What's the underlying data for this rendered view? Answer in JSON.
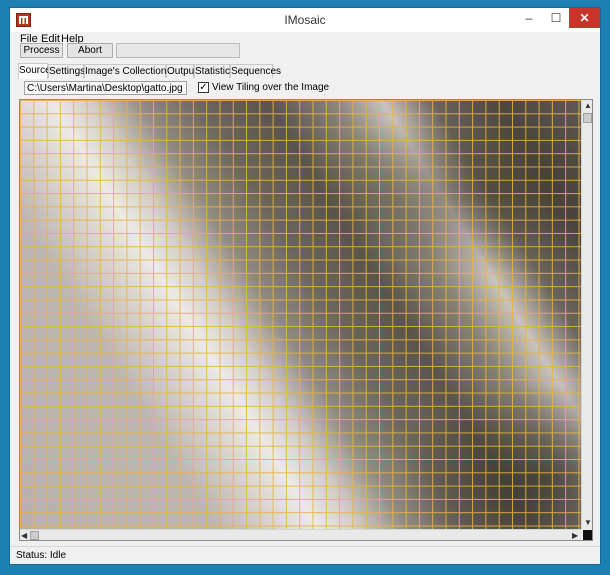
{
  "window": {
    "title": "IMosaic"
  },
  "window_controls": {
    "minimize": "–",
    "maximize": "☐",
    "close": "✕"
  },
  "menu": {
    "items": [
      "File",
      "Edit",
      "Help"
    ]
  },
  "toolbar": {
    "process_label": "Process",
    "abort_label": "Abort"
  },
  "tabs": [
    "Source",
    "Settings",
    "Image's Collections",
    "Output",
    "Statistics",
    "Sequences"
  ],
  "active_tab": "Source",
  "source": {
    "path": "C:\\Users\\Martina\\Desktop\\gatto.jpg",
    "view_tiling_checked": true,
    "view_tiling_label": "View Tiling over the Image"
  },
  "scroll": {
    "up": "▲",
    "down": "▼",
    "left": "◀",
    "right": "▶"
  },
  "status": {
    "text": "Status: Idle"
  },
  "colors": {
    "tile_grid": "#e8b43e",
    "close_button": "#c7352b",
    "desktop": "#1d80b3"
  }
}
